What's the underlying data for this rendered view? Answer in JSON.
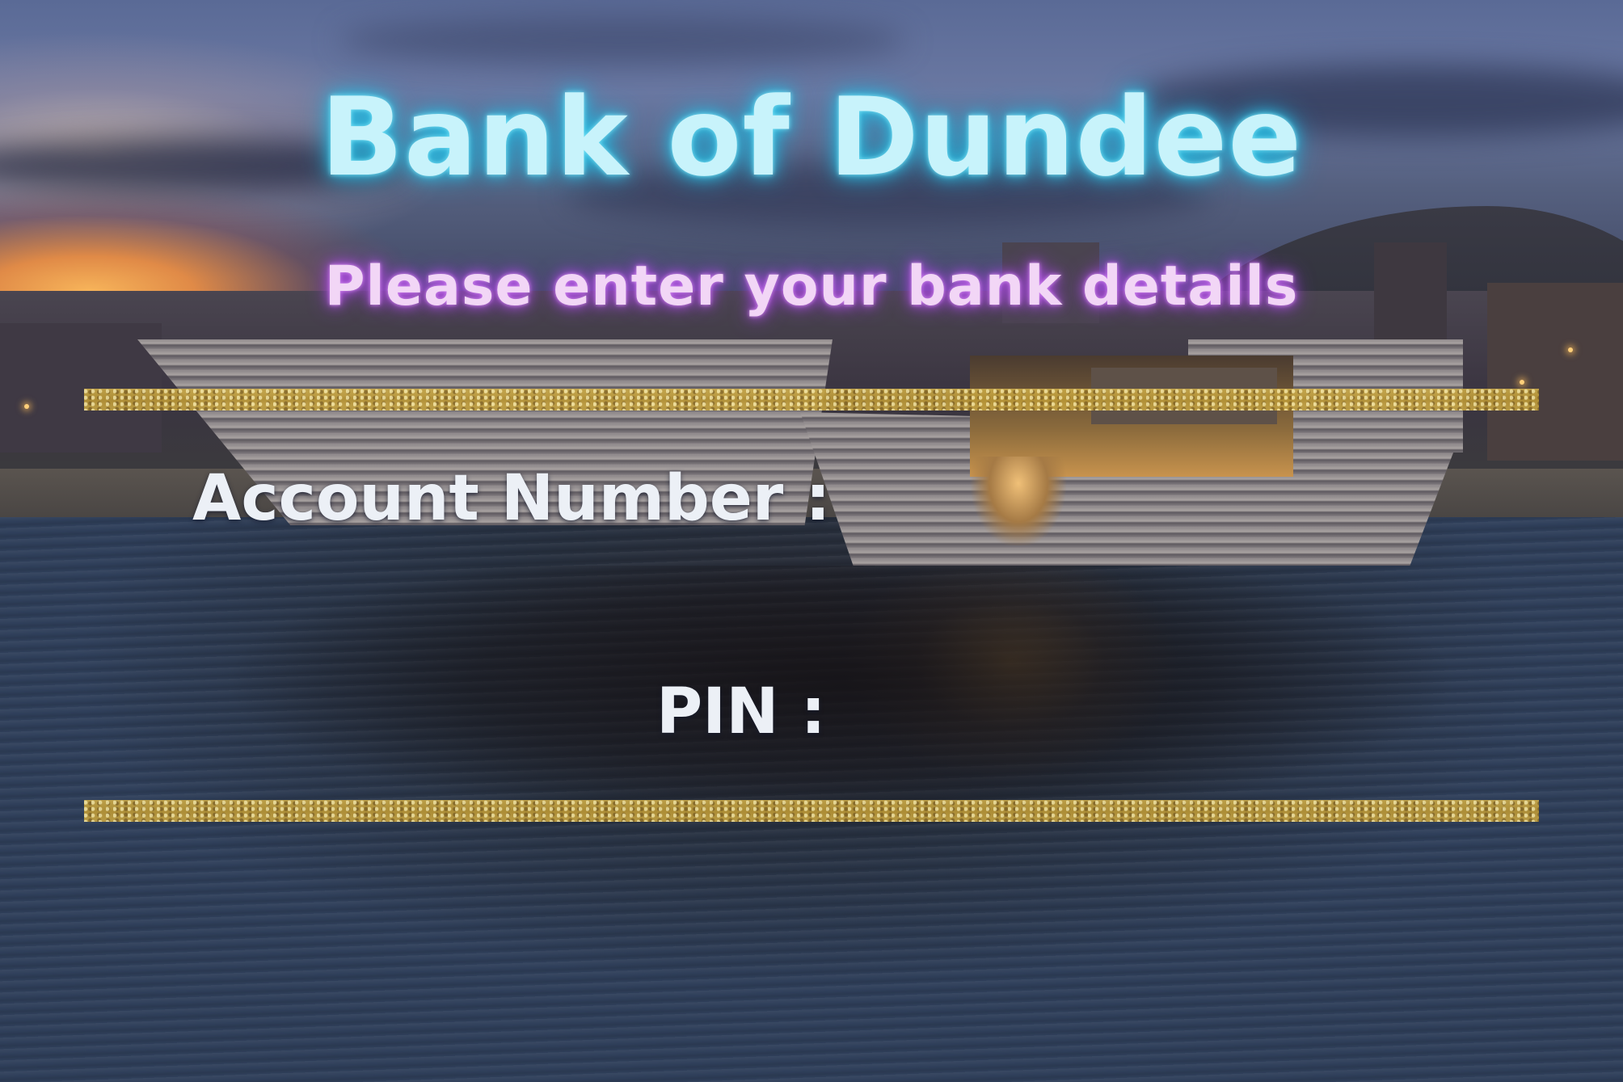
{
  "page": {
    "title": "Bank of Dundee",
    "subtitle": "Please enter your bank details"
  },
  "form": {
    "account_number": {
      "label": "Account Number :",
      "value": "",
      "placeholder": ""
    },
    "pin": {
      "label": "PIN :",
      "value": "",
      "placeholder": ""
    }
  },
  "colors": {
    "title_glow": "#19a8d6",
    "subtitle_glow": "#b553e6",
    "divider_gold": "#c9a94a",
    "label_text": "#ecf0f6"
  }
}
